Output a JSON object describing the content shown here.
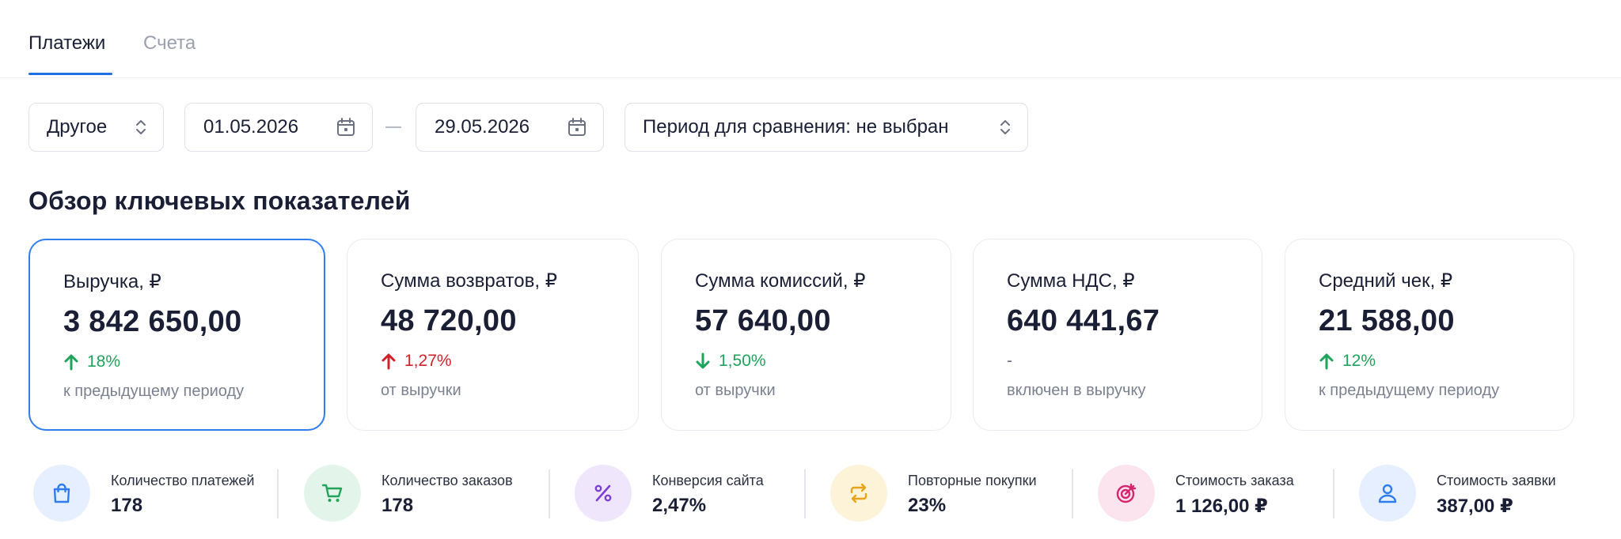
{
  "tabs": [
    {
      "label": "Платежи",
      "active": true
    },
    {
      "label": "Счета",
      "active": false
    }
  ],
  "filters": {
    "period_select": "Другое",
    "date_from": "01.05.2026",
    "date_to": "29.05.2026",
    "compare_select": "Период для сравнения: не выбран"
  },
  "section_title": "Обзор ключевых показателей",
  "cards": [
    {
      "label": "Выручка, ₽",
      "value": "3 842 650,00",
      "delta": "18%",
      "trend": "up",
      "note": "к предыдущему периоду",
      "selected": true
    },
    {
      "label": "Сумма возвратов, ₽",
      "value": "48 720,00",
      "delta": "1,27%",
      "trend": "up-bad",
      "note": "от выручки",
      "selected": false
    },
    {
      "label": "Сумма комиссий, ₽",
      "value": "57 640,00",
      "delta": "1,50%",
      "trend": "down-good",
      "note": "от выручки",
      "selected": false
    },
    {
      "label": "Сумма НДС, ₽",
      "value": "640 441,67",
      "delta": "-",
      "trend": "none",
      "note": "включен в выручку",
      "selected": false
    },
    {
      "label": "Средний чек, ₽",
      "value": "21 588,00",
      "delta": "12%",
      "trend": "up",
      "note": "к предыдущему периоду",
      "selected": false
    }
  ],
  "stats": [
    {
      "label": "Количество платежей",
      "value": "178",
      "icon": "shopping-bag-icon",
      "color": "#2f7ef0",
      "bg": "#e6efff"
    },
    {
      "label": "Количество заказов",
      "value": "178",
      "icon": "cart-icon",
      "color": "#22a35a",
      "bg": "#e3f5ea"
    },
    {
      "label": "Конверсия сайта",
      "value": "2,47%",
      "icon": "percent-icon",
      "color": "#7b3fd6",
      "bg": "#efe6fb"
    },
    {
      "label": "Повторные покупки",
      "value": "23%",
      "icon": "repeat-icon",
      "color": "#e8a316",
      "bg": "#fdf3d8"
    },
    {
      "label": "Стоимость заказа",
      "value": "1 126,00 ₽",
      "icon": "target-icon",
      "color": "#d6246e",
      "bg": "#fce4ee"
    },
    {
      "label": "Стоимость заявки",
      "value": "387,00 ₽",
      "icon": "user-icon",
      "color": "#2f7ef0",
      "bg": "#e6efff"
    }
  ],
  "colors": {
    "accent": "#2f7ef0",
    "positive": "#1ea35a",
    "negative": "#d0212a"
  }
}
